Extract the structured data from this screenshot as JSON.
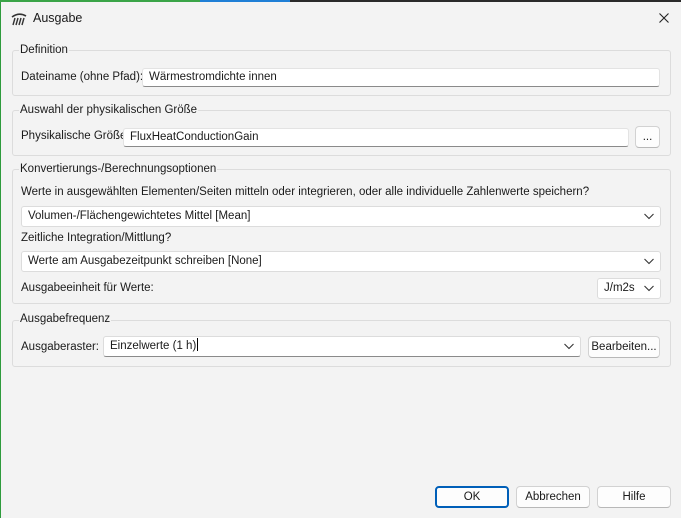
{
  "window": {
    "title": "Ausgabe",
    "app_icon": "app-logo-icon",
    "close_icon": "close-icon"
  },
  "definition": {
    "legend": "Definition",
    "filename_label": "Dateiname (ohne Pfad):",
    "filename_value": "Wärmestromdichte innen"
  },
  "physical": {
    "legend": "Auswahl der physikalischen Größe",
    "quantity_label": "Physikalische Größe:",
    "quantity_value": "FluxHeatConductionGain",
    "browse_label": "..."
  },
  "conversion": {
    "legend": "Konvertierungs-/Berechnungsoptionen",
    "averaging_question": "Werte in ausgewählten Elementen/Seiten mitteln oder integrieren, oder alle individuelle Zahlenwerte speichern?",
    "averaging_value": "Volumen-/Flächengewichtetes Mittel [Mean]",
    "time_label": "Zeitliche Integration/Mittlung?",
    "time_value": "Werte am Ausgabezeitpunkt schreiben [None]",
    "unit_label": "Ausgabeeinheit für Werte:",
    "unit_value": "J/m2s"
  },
  "frequency": {
    "legend": "Ausgabefrequenz",
    "grid_label": "Ausgaberaster:",
    "grid_value": "Einzelwerte (1 h)",
    "edit_label": "Bearbeiten..."
  },
  "buttons": {
    "ok": "OK",
    "cancel": "Abbrechen",
    "help": "Hilfe"
  },
  "colors": {
    "accent": "#005fb8",
    "window_bg": "#f3f3f3",
    "field_bg": "#ffffff"
  }
}
